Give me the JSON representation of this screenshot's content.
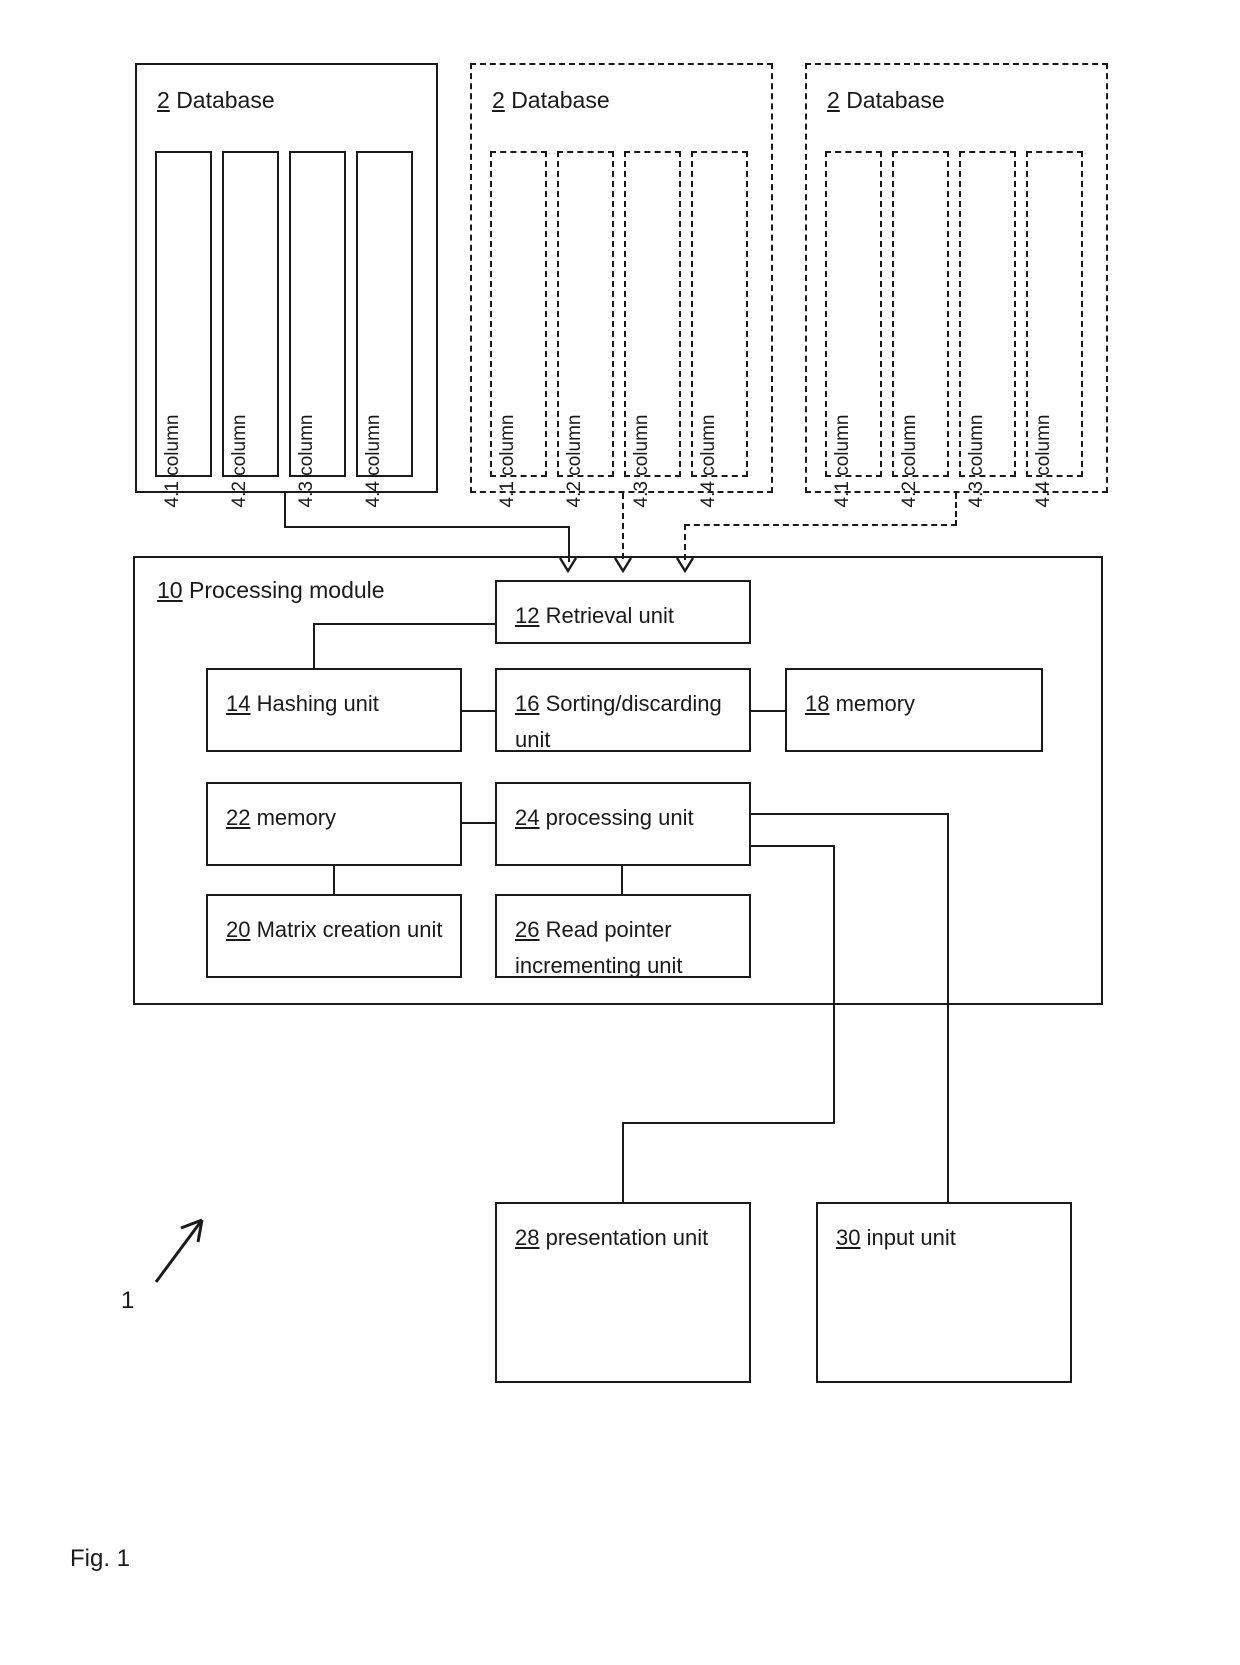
{
  "figure": {
    "caption": "Fig. 1",
    "system_reference": "1"
  },
  "databases": [
    {
      "ref": "2",
      "title": "Database",
      "style": "solid",
      "columns": [
        {
          "label": "4.1 column"
        },
        {
          "label": "4.2 column"
        },
        {
          "label": "4.3 column"
        },
        {
          "label": "4.4 column"
        }
      ]
    },
    {
      "ref": "2",
      "title": "Database",
      "style": "dashed",
      "columns": [
        {
          "label": "4.1 column"
        },
        {
          "label": "4.2 column"
        },
        {
          "label": "4.3 column"
        },
        {
          "label": "4.4 column"
        }
      ]
    },
    {
      "ref": "2",
      "title": "Database",
      "style": "dashed",
      "columns": [
        {
          "label": "4.1 column"
        },
        {
          "label": "4.2 column"
        },
        {
          "label": "4.3 column"
        },
        {
          "label": "4.4 column"
        }
      ]
    }
  ],
  "processing_module": {
    "ref": "10",
    "title": "Processing module",
    "units": {
      "retrieval": {
        "ref": "12",
        "label": "Retrieval unit"
      },
      "hashing": {
        "ref": "14",
        "label": "Hashing unit"
      },
      "sorting": {
        "ref": "16",
        "label": "Sorting/discarding unit"
      },
      "memory_18": {
        "ref": "18",
        "label": "memory"
      },
      "memory_22": {
        "ref": "22",
        "label": "memory"
      },
      "processing": {
        "ref": "24",
        "label": "processing unit"
      },
      "matrix": {
        "ref": "20",
        "label": "Matrix creation unit"
      },
      "read_pointer": {
        "ref": "26",
        "label": "Read pointer incrementing unit"
      }
    }
  },
  "external_units": {
    "presentation": {
      "ref": "28",
      "label": "presentation unit"
    },
    "input": {
      "ref": "30",
      "label": "input unit"
    }
  },
  "colors": {
    "stroke": "#1a1a1a",
    "background": "#ffffff"
  }
}
